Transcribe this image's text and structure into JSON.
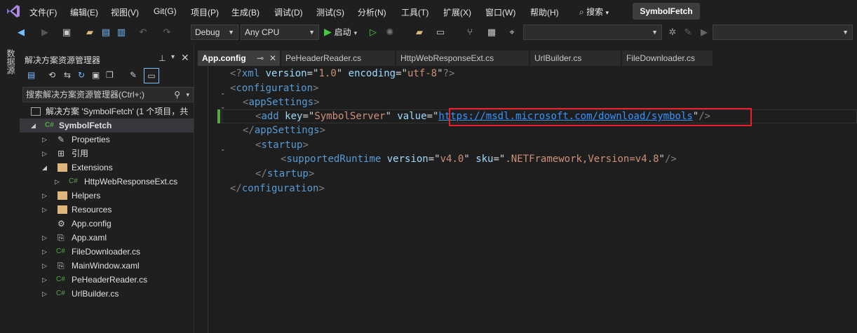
{
  "menu": {
    "items": [
      "文件(F)",
      "编辑(E)",
      "视图(V)",
      "Git(G)",
      "项目(P)",
      "生成(B)",
      "调试(D)",
      "测试(S)",
      "分析(N)",
      "工具(T)",
      "扩展(X)",
      "窗口(W)",
      "帮助(H)"
    ],
    "search_label": "搜索",
    "solution_name": "SymbolFetch"
  },
  "toolbar": {
    "config": "Debug",
    "platform": "Any CPU",
    "start_label": "启动"
  },
  "side_strip": {
    "label": "数据源"
  },
  "explorer": {
    "title": "解决方案资源管理器",
    "search_placeholder": "搜索解决方案资源管理器(Ctrl+;)",
    "items": [
      {
        "label": "解决方案 'SymbolFetch' (1 个项目，共"
      },
      {
        "label": "SymbolFetch"
      },
      {
        "label": "Properties"
      },
      {
        "label": "引用"
      },
      {
        "label": "Extensions"
      },
      {
        "label": "HttpWebResponseExt.cs"
      },
      {
        "label": "Helpers"
      },
      {
        "label": "Resources"
      },
      {
        "label": "App.config"
      },
      {
        "label": "App.xaml"
      },
      {
        "label": "FileDownloader.cs"
      },
      {
        "label": "MainWindow.xaml"
      },
      {
        "label": "PeHeaderReader.cs"
      },
      {
        "label": "UrlBuilder.cs"
      }
    ]
  },
  "tabs": [
    "App.config",
    "PeHeaderReader.cs",
    "HttpWebResponseExt.cs",
    "UrlBuilder.cs",
    "FileDownloader.cs"
  ],
  "editor": {
    "xml_decl": {
      "version": "1.0",
      "encoding": "utf-8"
    },
    "root": "configuration",
    "app_settings": "appSettings",
    "add_key": "SymbolServer",
    "add_value": "https://msdl.microsoft.com/download/symbols",
    "startup": "startup",
    "runtime_tag": "supportedRuntime",
    "runtime_version": "v4.0",
    "runtime_sku": ".NETFramework,Version=v4.8"
  },
  "colors": {
    "highlight_box": "#e8202a",
    "link": "#3794ff",
    "accent": "#75beff"
  }
}
